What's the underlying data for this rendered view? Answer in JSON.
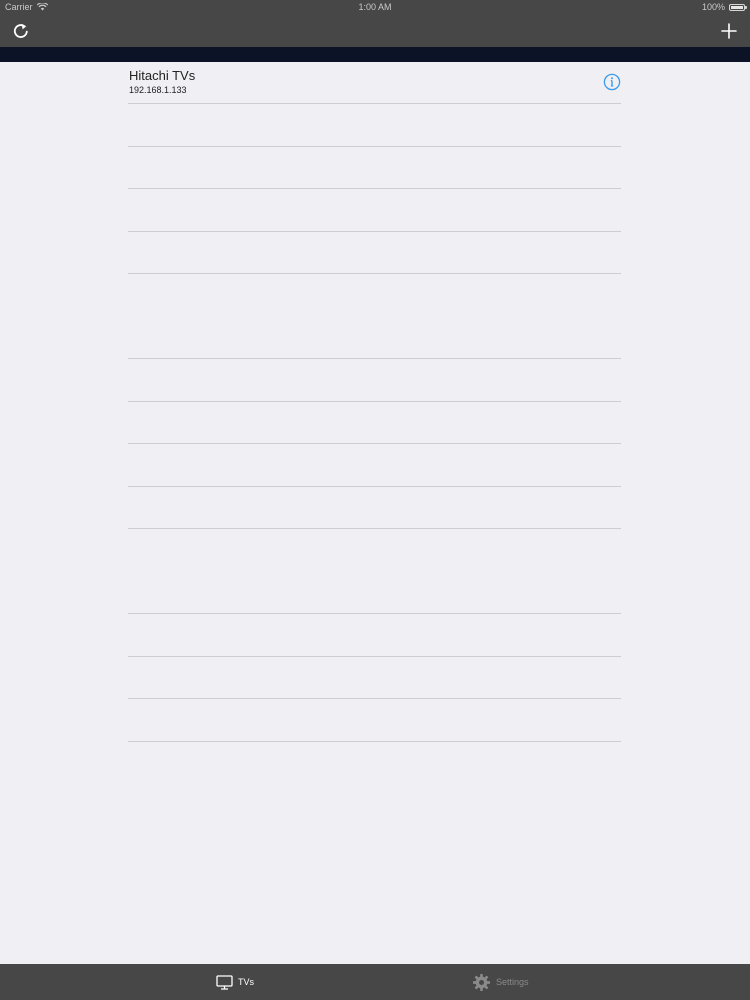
{
  "status_bar": {
    "carrier": "Carrier",
    "time": "1:00 AM",
    "battery": "100%"
  },
  "nav": {
    "left_icon": "refresh-icon",
    "right_icon": "add-icon"
  },
  "devices": [
    {
      "name": "Hitachi TVs",
      "ip": "192.168.1.133"
    }
  ],
  "tabs": [
    {
      "label": "TVs",
      "icon": "tv-icon",
      "selected": true
    },
    {
      "label": "Settings",
      "icon": "gear-icon",
      "selected": false
    }
  ],
  "colors": {
    "bar_bg": "#474747",
    "accent": "#3d9be9",
    "background": "#efeff4"
  }
}
